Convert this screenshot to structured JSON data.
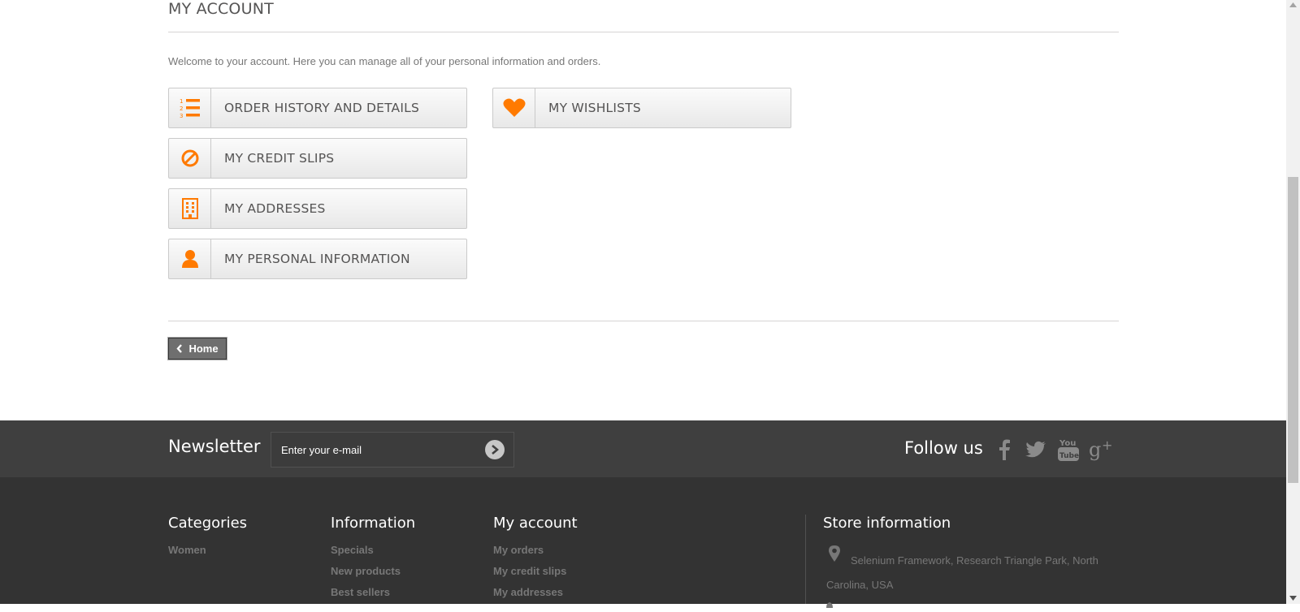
{
  "page": {
    "title": "MY ACCOUNT",
    "welcome": "Welcome to your account. Here you can manage all of your personal information and orders."
  },
  "account_links": [
    {
      "label": "ORDER HISTORY AND DETAILS",
      "icon": "ordered-list-icon"
    },
    {
      "label": "MY CREDIT SLIPS",
      "icon": "ban-icon"
    },
    {
      "label": "MY ADDRESSES",
      "icon": "building-icon"
    },
    {
      "label": "MY PERSONAL INFORMATION",
      "icon": "user-icon"
    },
    {
      "label": "MY WISHLISTS",
      "icon": "heart-icon"
    }
  ],
  "home_button": {
    "label": "Home"
  },
  "newsletter": {
    "title": "Newsletter",
    "placeholder": "Enter your e-mail"
  },
  "follow": {
    "title": "Follow us",
    "networks": [
      "facebook",
      "twitter",
      "youtube",
      "google-plus"
    ]
  },
  "footer": {
    "categories": {
      "title": "Categories",
      "links": [
        "Women"
      ]
    },
    "information": {
      "title": "Information",
      "links": [
        "Specials",
        "New products",
        "Best sellers"
      ]
    },
    "my_account": {
      "title": "My account",
      "links": [
        "My orders",
        "My credit slips",
        "My addresses"
      ]
    },
    "store": {
      "title": "Store information",
      "address": "Selenium Framework, Research Triangle Park, North Carolina, USA"
    }
  },
  "colors": {
    "accent": "#f13340",
    "icon_orange": "#ff7a00",
    "footer_dark": "#333333",
    "newsletter_bar": "#3f3f3f"
  }
}
